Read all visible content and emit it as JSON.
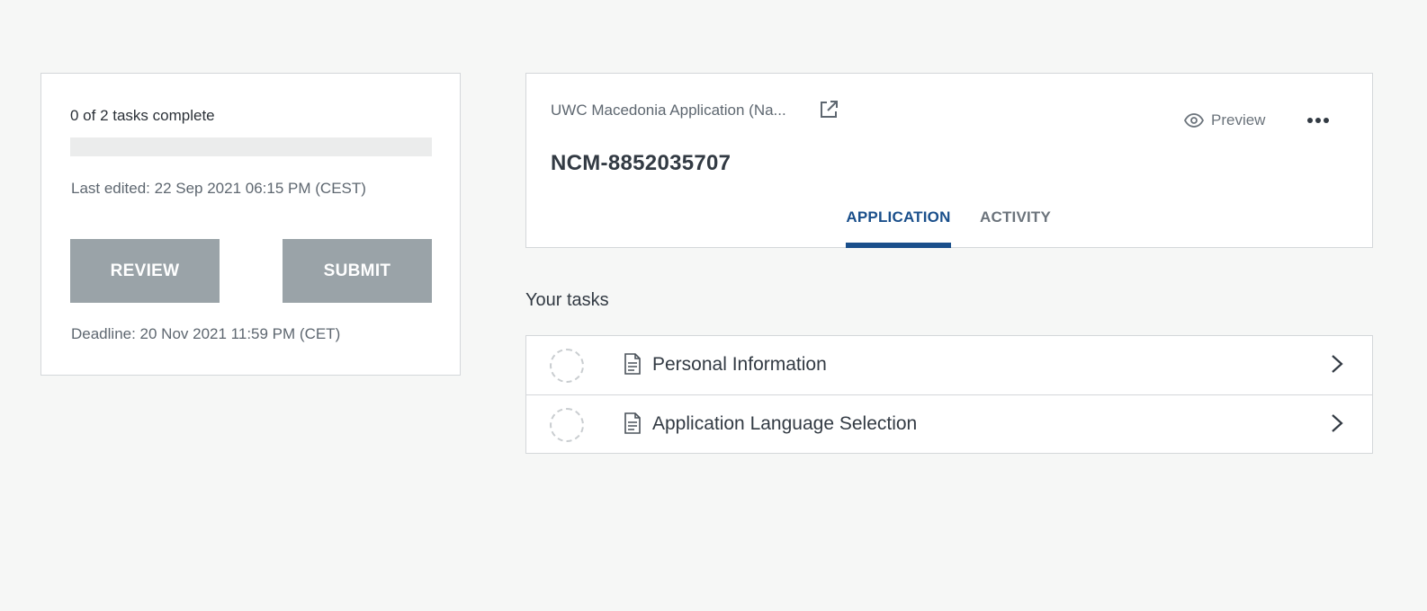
{
  "summary": {
    "tasks_complete": "0 of 2 tasks complete",
    "progress": 0,
    "last_edited": "Last edited: 22 Sep 2021 06:15 PM (CEST)",
    "review_label": "REVIEW",
    "submit_label": "SUBMIT",
    "deadline": "Deadline: 20 Nov 2021 11:59 PM (CET)"
  },
  "application": {
    "title": "UWC Macedonia Application (Na...",
    "id": "NCM-8852035707",
    "preview_label": "Preview",
    "tabs": [
      {
        "label": "APPLICATION",
        "active": true
      },
      {
        "label": "ACTIVITY",
        "active": false
      }
    ]
  },
  "tasks": {
    "heading": "Your tasks",
    "items": [
      {
        "label": "Personal Information",
        "status": "incomplete"
      },
      {
        "label": "Application Language Selection",
        "status": "incomplete"
      }
    ]
  },
  "icons": {
    "external": "external-link-icon",
    "preview": "eye-icon",
    "more": "more-horizontal-icon",
    "document": "document-icon",
    "chevron": "chevron-right-icon"
  },
  "colors": {
    "accent": "#1a4f8b",
    "button_disabled": "#9aa3a8",
    "border": "#d4d7da",
    "background": "#f6f7f6"
  }
}
